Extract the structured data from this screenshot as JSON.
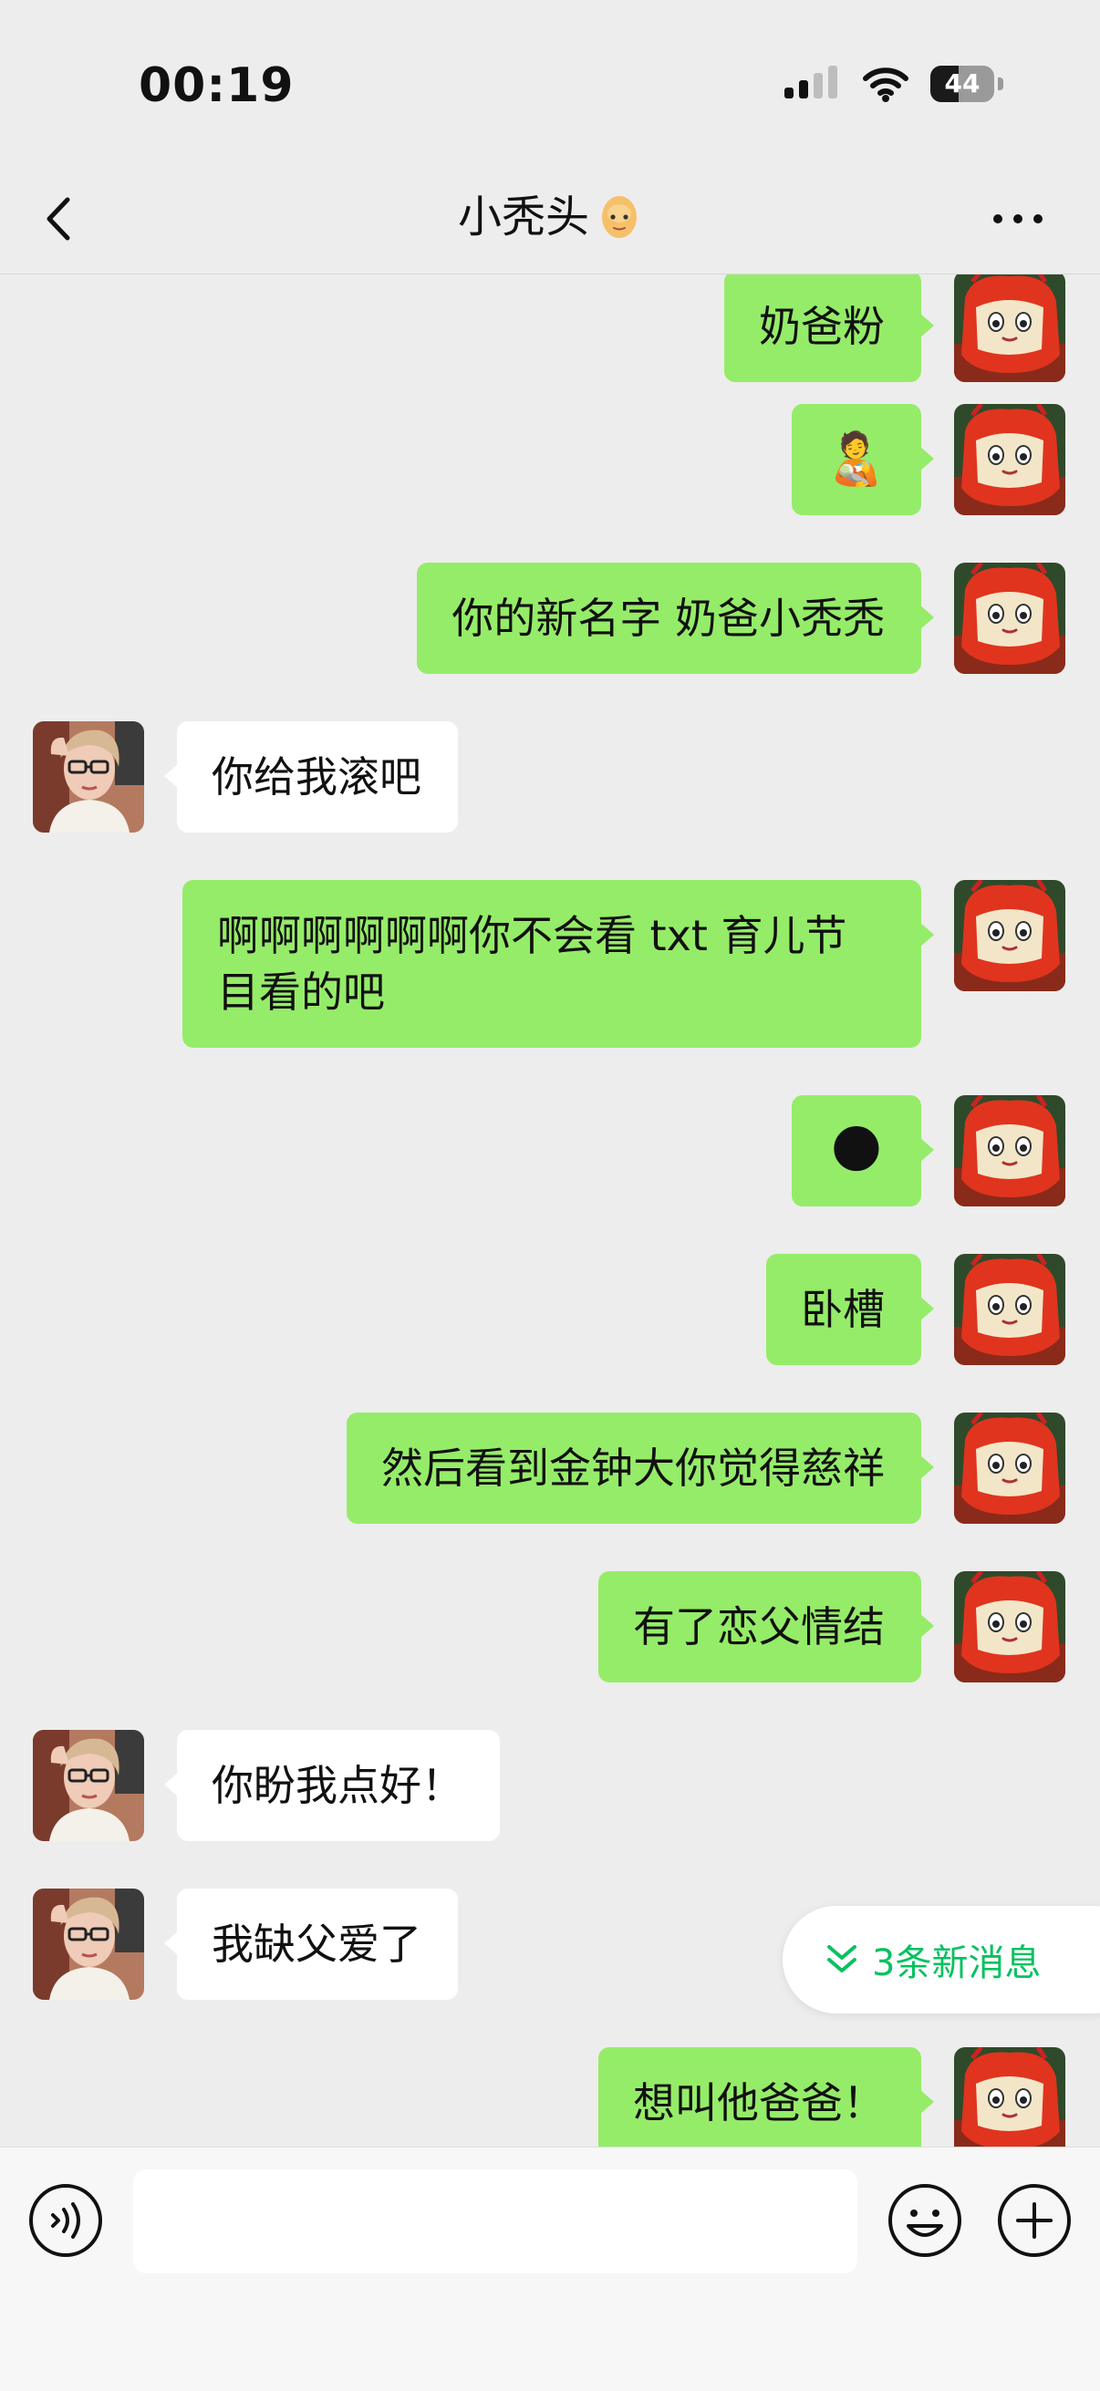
{
  "status_bar": {
    "time": "00:19",
    "battery": "44"
  },
  "header": {
    "title": "小秃头"
  },
  "messages": [
    {
      "sender": "me",
      "text": "奶爸粉"
    },
    {
      "sender": "me",
      "emoji": "🧑‍🍼"
    },
    {
      "sender": "me",
      "text": "你的新名字 奶爸小秃秃"
    },
    {
      "sender": "her",
      "text": "你给我滚吧"
    },
    {
      "sender": "me",
      "text": "啊啊啊啊啊啊你不会看 txt 育儿节目看的吧"
    },
    {
      "sender": "me",
      "emoji": "🌑"
    },
    {
      "sender": "me",
      "text": "卧槽"
    },
    {
      "sender": "me",
      "text": "然后看到金钟大你觉得慈祥"
    },
    {
      "sender": "me",
      "text": "有了恋父情结"
    },
    {
      "sender": "her",
      "text": "你盼我点好！"
    },
    {
      "sender": "her",
      "text": "我缺父爱了"
    },
    {
      "sender": "me",
      "text": "想叫他爸爸！"
    }
  ],
  "new_messages": {
    "label": "3条新消息"
  },
  "input": {
    "value": "",
    "placeholder": ""
  },
  "icons": {
    "back": "chevron-left-icon",
    "more": "ellipsis-icon",
    "voice": "voice-icon",
    "emoji": "emoji-icon",
    "plus": "plus-icon",
    "title_face": "face-icon"
  },
  "colors": {
    "background": "#ededed",
    "my_bubble": "#95ec69",
    "her_bubble": "#ffffff",
    "accent": "#07c160"
  }
}
